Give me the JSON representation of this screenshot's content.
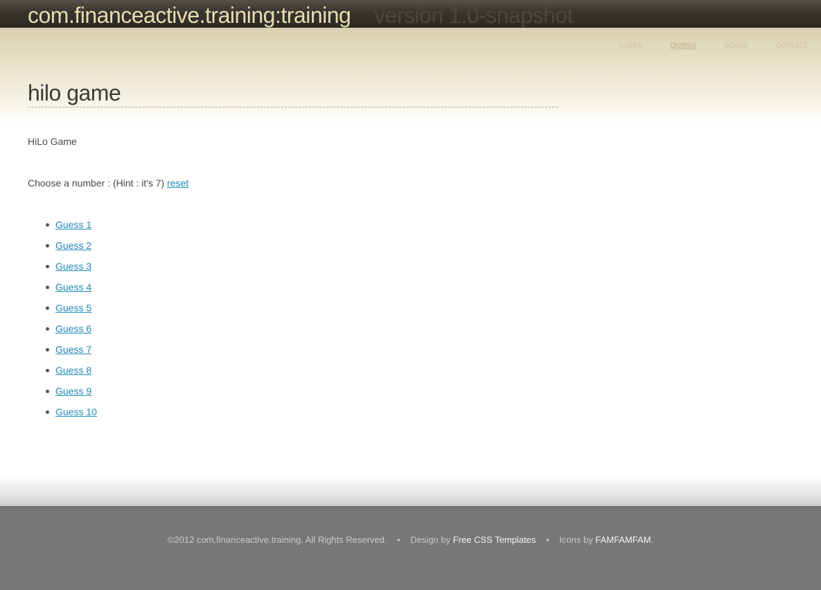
{
  "header": {
    "site_title": "com.financeactive.training:training",
    "version": "version 1.0-snapshot",
    "nav": [
      {
        "label": "index",
        "active": false
      },
      {
        "label": "guess",
        "active": true
      },
      {
        "label": "about",
        "active": false
      },
      {
        "label": "contact",
        "active": false
      }
    ]
  },
  "main": {
    "page_title": "hilo game",
    "intro": "HiLo Game",
    "choose_text": "Choose a number : (Hint : it's 7)",
    "reset_label": "reset",
    "guesses": [
      "Guess 1",
      "Guess 2",
      "Guess 3",
      "Guess 4",
      "Guess 5",
      "Guess 6",
      "Guess 7",
      "Guess 8",
      "Guess 9",
      "Guess 10"
    ]
  },
  "footer": {
    "copyright": "©2012 com.financeactive.training. All Rights Reserved.",
    "separator": "•",
    "design_prefix": "Design by",
    "design_link": "Free CSS Templates",
    "icons_prefix": "Icons by",
    "icons_link": "FAMFAMFAM",
    "icons_suffix": "."
  },
  "colors": {
    "link": "#1f88b8",
    "header_bar": "#2b2923",
    "title_text": "#e7dcb0",
    "footer_bg": "#777777"
  }
}
